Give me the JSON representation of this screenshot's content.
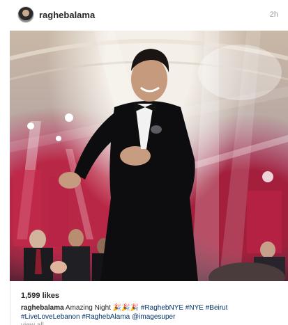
{
  "post": {
    "username": "raghebalama",
    "timestamp": "2h",
    "likes": "1,599 likes",
    "caption_user": "raghebalama",
    "caption_text": " Amazing Night 🎉🎉🎉 ",
    "caption_tags": "#RaghebNYE #NYE #Beirut #LiveLoveLebanon #RaghebAlama @imagesuper",
    "comments_peek": "view all comments"
  }
}
